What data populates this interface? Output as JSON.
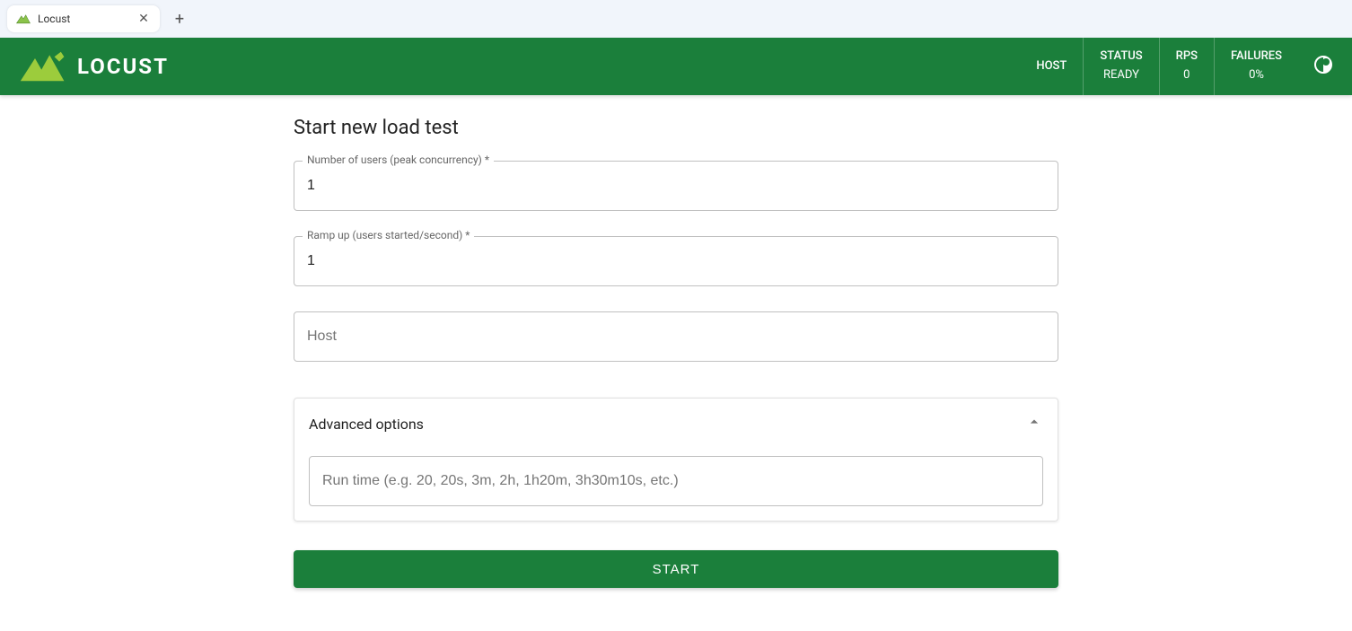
{
  "browser": {
    "tab_title": "Locust"
  },
  "header": {
    "logo_text": "LOCUST",
    "stats": {
      "host_label": "HOST",
      "host_value": "",
      "status_label": "STATUS",
      "status_value": "READY",
      "rps_label": "RPS",
      "rps_value": "0",
      "failures_label": "FAILURES",
      "failures_value": "0%"
    }
  },
  "form": {
    "title": "Start new load test",
    "users_label": "Number of users (peak concurrency) *",
    "users_value": "1",
    "rampup_label": "Ramp up (users started/second) *",
    "rampup_value": "1",
    "host_placeholder": "Host",
    "host_value": "",
    "advanced_label": "Advanced options",
    "runtime_placeholder": "Run time (e.g. 20, 20s, 3m, 2h, 1h20m, 3h30m10s, etc.)",
    "runtime_value": "",
    "start_button": "START"
  }
}
